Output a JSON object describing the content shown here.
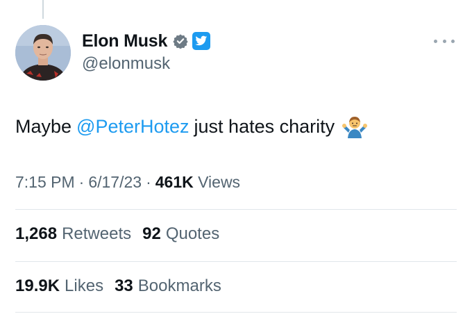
{
  "author": {
    "display_name": "Elon Musk",
    "handle": "@elonmusk",
    "avatar_icon": "profile-photo",
    "verified_icon": "verified-badge-icon",
    "platform_icon": "twitter-bird-icon"
  },
  "tweet": {
    "text_before": "Maybe",
    "mention": "@PeterHotez",
    "text_after": "just hates charity",
    "emoji": "person-shrugging-emoji"
  },
  "meta": {
    "time": "7:15 PM",
    "separator": "·",
    "date": "6/17/23",
    "views_count": "461K",
    "views_label": "Views"
  },
  "stats": {
    "retweets_count": "1,268",
    "retweets_label": "Retweets",
    "quotes_count": "92",
    "quotes_label": "Quotes",
    "likes_count": "19.9K",
    "likes_label": "Likes",
    "bookmarks_count": "33",
    "bookmarks_label": "Bookmarks"
  },
  "colors": {
    "link": "#1d9bf0",
    "secondary_text": "#536471",
    "primary_text": "#0f1419",
    "divider": "#e1e6ea"
  }
}
